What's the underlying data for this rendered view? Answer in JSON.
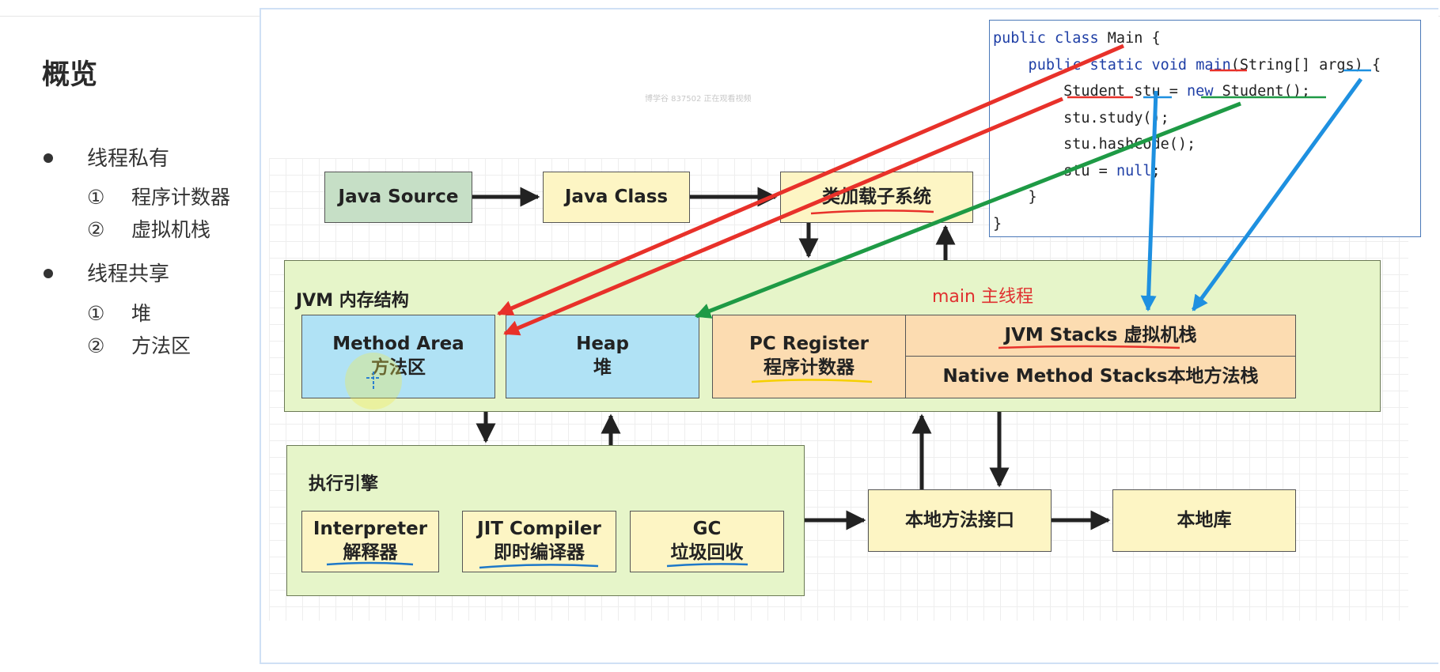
{
  "sidebar": {
    "title": "概览",
    "groups": [
      {
        "label": "线程私有",
        "items": [
          {
            "num": "①",
            "label": "程序计数器"
          },
          {
            "num": "②",
            "label": "虚拟机栈"
          }
        ]
      },
      {
        "label": "线程共享",
        "items": [
          {
            "num": "①",
            "label": "堆"
          },
          {
            "num": "②",
            "label": "方法区"
          }
        ]
      }
    ]
  },
  "watermark": "博学谷 837502 正在观看视频",
  "diagram": {
    "java_source": "Java Source",
    "java_class": "Java Class",
    "class_loader": "类加载子系统",
    "jvm_memory_label": "JVM 内存结构",
    "main_thread_label": "main 主线程",
    "method_area": {
      "en": "Method Area",
      "zh": "方法区"
    },
    "heap": {
      "en": "Heap",
      "zh": "堆"
    },
    "pc_register": {
      "en": "PC Register",
      "zh": "程序计数器"
    },
    "jvm_stacks": "JVM Stacks 虚拟机栈",
    "native_stacks": "Native Method Stacks本地方法栈",
    "exec_engine_label": "执行引擎",
    "interpreter": {
      "en": "Interpreter",
      "zh": "解释器"
    },
    "jit": {
      "en": "JIT Compiler",
      "zh": "即时编译器"
    },
    "gc": {
      "en": "GC",
      "zh": "垃圾回收"
    },
    "native_interface": "本地方法接口",
    "native_lib": "本地库"
  },
  "code": {
    "l1a": "public class",
    "l1b": " Main {",
    "l2a": "    public static void",
    "l2b": " ",
    "l2c": "main",
    "l2d": "(String[] args) {",
    "l3a": "        Student stu = ",
    "l3b": "new",
    "l3c": " Student();",
    "l4": "        stu.study();",
    "l5": "        stu.hashCode();",
    "l6a": "        stu = ",
    "l6b": "null",
    "l6c": ";",
    "l7": "    }",
    "l8": "}"
  },
  "colors": {
    "red_arrow": "#e8312a",
    "green_arrow": "#1e9a45",
    "blue_arrow": "#1e90e0"
  }
}
